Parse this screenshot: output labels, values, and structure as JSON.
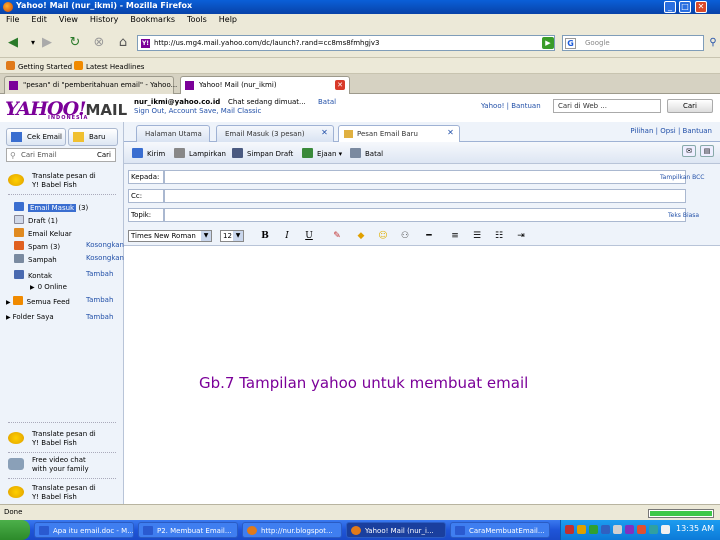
{
  "window": {
    "title": "Yahoo! Mail (nur_ikmi) - Mozilla Firefox"
  },
  "menu": [
    "File",
    "Edit",
    "View",
    "History",
    "Bookmarks",
    "Tools",
    "Help"
  ],
  "nav": {
    "url": "http://us.mg4.mail.yahoo.com/dc/launch?.rand=cc8ms8fmhgjv3",
    "search_placeholder": "Google"
  },
  "bookmarks": [
    "Getting Started",
    "Latest Headlines"
  ],
  "browser_tabs": [
    {
      "label": "\"pesan\" di \"pemberitahuan email\" - Yahoo...",
      "active": false
    },
    {
      "label": "Yahoo! Mail (nur_ikmi)",
      "active": true
    }
  ],
  "yahoo": {
    "logo": "YAHOO!",
    "logo_mail": "MAIL",
    "logo_sub": "INDONESIA",
    "user_email": "nur_ikmi@yahoo.co.id",
    "chat_status": "Chat sedang dimuat...",
    "chat_cancel": "Batal",
    "account_links": "Sign Out, Account Save, Mail Classic",
    "top_links": "Yahoo! | Bantuan",
    "web_search_placeholder": "Cari di Web ...",
    "search_button": "Cari"
  },
  "left": {
    "compose_button": "Cek Email",
    "new_button": "Baru",
    "search_placeholder": "Cari Email",
    "search_button": "Cari",
    "promo_top": [
      "Translate pesan di",
      "Y! Babel Fish"
    ],
    "folders": [
      {
        "label": "Email Masuk",
        "count": "(3)",
        "side": ""
      },
      {
        "label": "Draft",
        "count": "(1)",
        "side": ""
      },
      {
        "label": "Email Keluar",
        "count": "",
        "side": ""
      },
      {
        "label": "Spam",
        "count": "(3)",
        "side": "Kosongkan"
      },
      {
        "label": "Sampah",
        "count": "",
        "side": "Kosongkan"
      },
      {
        "label": "Kontak",
        "count": "",
        "side": "Tambah"
      },
      {
        "label": "0 Online",
        "count": "",
        "side": ""
      },
      {
        "label": "Semua Feed",
        "count": "",
        "side": "Tambah"
      },
      {
        "label": "Folder Saya",
        "count": "",
        "side": "Tambah"
      }
    ],
    "promo_bottom_1": [
      "Translate pesan di",
      "Y! Babel Fish"
    ],
    "promo_bottom_2": [
      "Free video chat",
      "with your family"
    ],
    "promo_bottom_3": [
      "Translate pesan di",
      "Y! Babel Fish"
    ]
  },
  "tabs": [
    {
      "label": "Halaman Utama",
      "active": false
    },
    {
      "label": "Email Masuk (3 pesan)",
      "active": false
    },
    {
      "label": "Pesan Email Baru",
      "active": true
    }
  ],
  "tab_right_links": "Pilihan | Opsi | Bantuan",
  "compose_toolbar": [
    "Kirim",
    "Lampirkan",
    "Simpan Draft",
    "Ejaan",
    "Batal"
  ],
  "form": {
    "to_label": "Kepada:",
    "cc_label": "Cc:",
    "subject_label": "Topik:",
    "to_value": "",
    "cc_value": "",
    "subject_value": "",
    "show_bcc": "Tampilkan BCC",
    "plain_text": "Teks Biasa"
  },
  "format": {
    "font": "Times New Roman",
    "size": "12"
  },
  "caption": "Gb.7 Tampilan yahoo untuk membuat email",
  "status": {
    "text": "Done",
    "progress": 1.0
  },
  "taskbar": {
    "items": [
      {
        "label": "Apa itu email.doc - M...",
        "active": false
      },
      {
        "label": "P2. Membuat Email...",
        "active": false
      },
      {
        "label": "http://nur.blogspot...",
        "active": false
      },
      {
        "label": "Yahoo! Mail (nur_i...",
        "active": true
      },
      {
        "label": "CaraMembuatEmail...",
        "active": false
      }
    ],
    "clock": "13:35 AM"
  },
  "colors": {
    "yahoo_purple": "#7b0099",
    "link_blue": "#2250a8",
    "xp_blue": "#1f55d8"
  }
}
